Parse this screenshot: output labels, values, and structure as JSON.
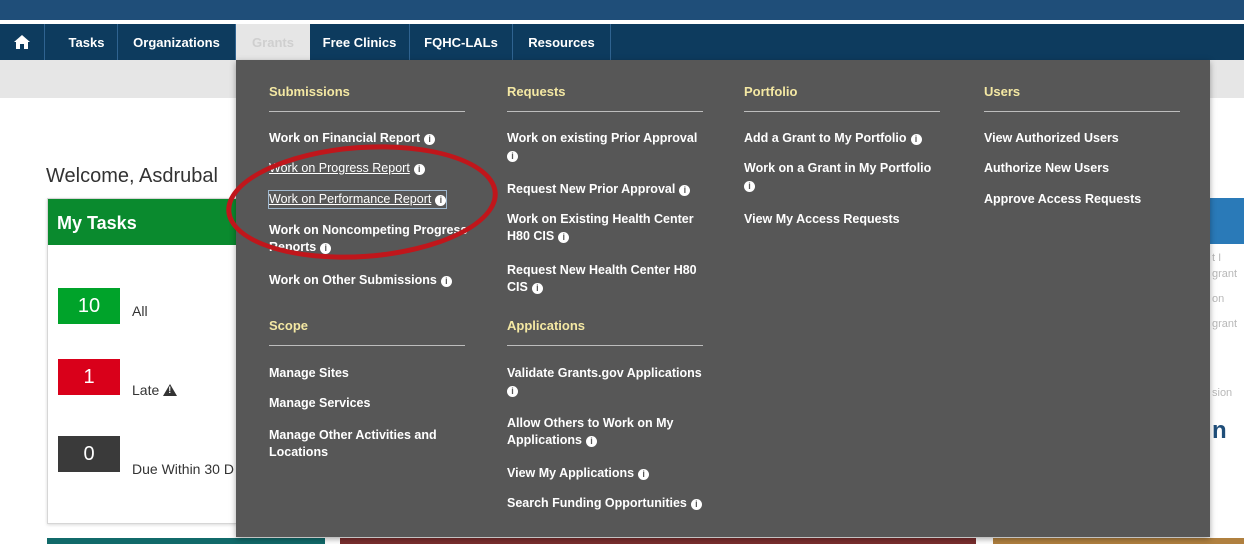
{
  "nav": {
    "tabs": [
      {
        "label": "Tasks"
      },
      {
        "label": "Organizations"
      },
      {
        "label": "Grants"
      },
      {
        "label": "Free Clinics"
      },
      {
        "label": "FQHC-LALs"
      },
      {
        "label": "Resources"
      }
    ]
  },
  "page": {
    "welcome": "Welcome, Asdrubal",
    "my_tasks": {
      "title": "My Tasks",
      "items": [
        {
          "count": "10",
          "label": "All",
          "color": "#00a32a"
        },
        {
          "count": "1",
          "label": "Late",
          "color": "#d9001a"
        },
        {
          "count": "0",
          "label": "Due Within 30 D",
          "color": "#3a3a3a"
        }
      ]
    },
    "right_fragments": [
      "t I",
      "grant",
      "on",
      "grant",
      "sion"
    ],
    "right_heading": "n"
  },
  "dropdown": {
    "submissions": {
      "heading": "Submissions",
      "items": [
        "Work on Financial Report",
        "Work on Progress Report",
        "Work on Performance Report",
        "Work on Noncompeting Progress",
        "Reports",
        "Work on Other Submissions"
      ]
    },
    "scope": {
      "heading": "Scope",
      "items": [
        "Manage Sites",
        "Manage Services",
        "Manage Other Activities and",
        "Locations"
      ]
    },
    "requests": {
      "heading": "Requests",
      "items": [
        "Work on existing Prior Approval",
        "Request New Prior Approval",
        "Work on Existing Health Center",
        "H80 CIS",
        "Request New Health Center H80",
        "CIS"
      ]
    },
    "applications": {
      "heading": "Applications",
      "items": [
        "Validate Grants.gov Applications",
        "Allow Others to Work on My",
        "Applications",
        "View My Applications",
        "Search Funding Opportunities"
      ]
    },
    "portfolio": {
      "heading": "Portfolio",
      "items": [
        "Add a Grant to My Portfolio",
        "Work on a Grant in My Portfolio",
        "View My Access Requests"
      ]
    },
    "users": {
      "heading": "Users",
      "items": [
        "View Authorized Users",
        "Authorize New Users",
        "Approve Access Requests"
      ]
    }
  },
  "colors": {
    "navbar": "#0d3b5e",
    "dropdown_bg": "#575757",
    "heading": "#f4e8a3",
    "annotation": "#c0161b"
  }
}
